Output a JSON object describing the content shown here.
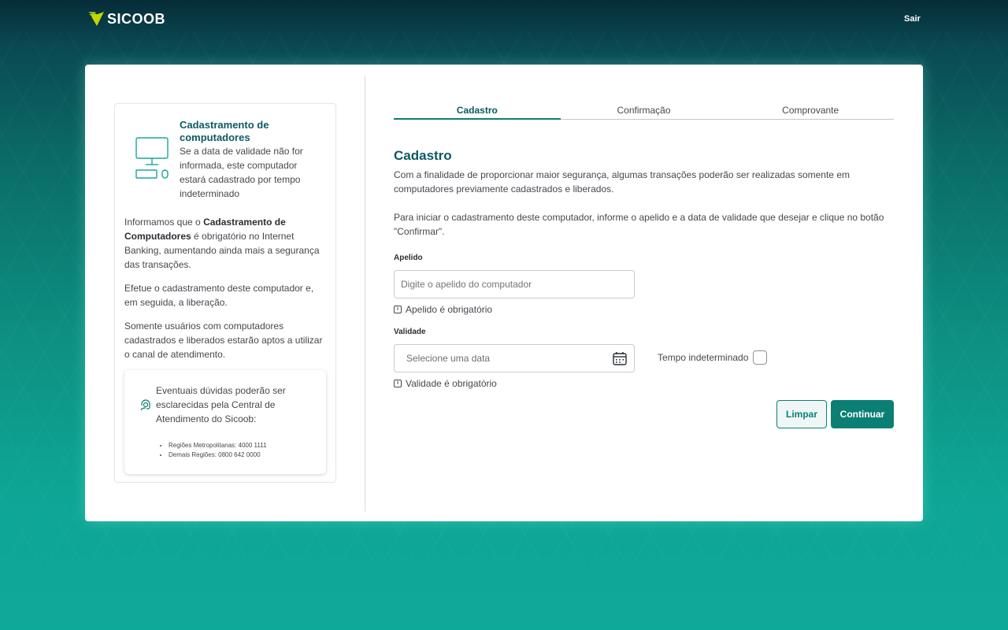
{
  "header": {
    "logo_text": "SICOOB",
    "logout_label": "Sair"
  },
  "info": {
    "title": "Cadastramento de computadores",
    "subtitle": "Se a data de validade não for informada, este computador estará cadastrado por tempo indeterminado",
    "para1_prefix": "Informamos que o ",
    "para1_bold": "Cadastramento de Computadores",
    "para1_suffix": " é obrigatório no Internet Banking, aumentando ainda mais a segurança das transações.",
    "para2": "Efetue o cadastramento deste computador e, em seguida, a liberação.",
    "para3": "Somente usuários com computadores cadastrados e liberados estarão aptos a utilizar o canal de atendimento.",
    "help_text": "Eventuais dúvidas poderão ser esclarecidas pela Central de Atendimento do Sicoob:",
    "help_items": [
      "Regiões Metropolitanas: 4000 1111",
      "Demais Regiões: 0800 642 0000"
    ]
  },
  "steps": [
    {
      "label": "Cadastro",
      "active": true
    },
    {
      "label": "Confirmação",
      "active": false
    },
    {
      "label": "Comprovante",
      "active": false
    }
  ],
  "form": {
    "title": "Cadastro",
    "desc1": "Com a finalidade de proporcionar maior segurança, algumas transações poderão ser realizadas somente em computadores previamente cadastrados e liberados.",
    "desc2": "Para iniciar o cadastramento deste computador, informe o apelido e a data de validade que desejar e clique no botão \"Confirmar\".",
    "nickname_label": "Apelido",
    "nickname_placeholder": "Digite o apelido do computador",
    "nickname_hint": "Apelido é obrigatório",
    "validity_label": "Validade",
    "validity_placeholder": "Selecione uma data",
    "validity_hint": "Validade é obrigatório",
    "indeterminate_label": "Tempo indeterminado",
    "clear_label": "Limpar",
    "continue_label": "Continuar"
  },
  "colors": {
    "brand_green": "#0c7f74",
    "title_teal": "#0b5a63",
    "logo_lime": "#c3d600"
  }
}
